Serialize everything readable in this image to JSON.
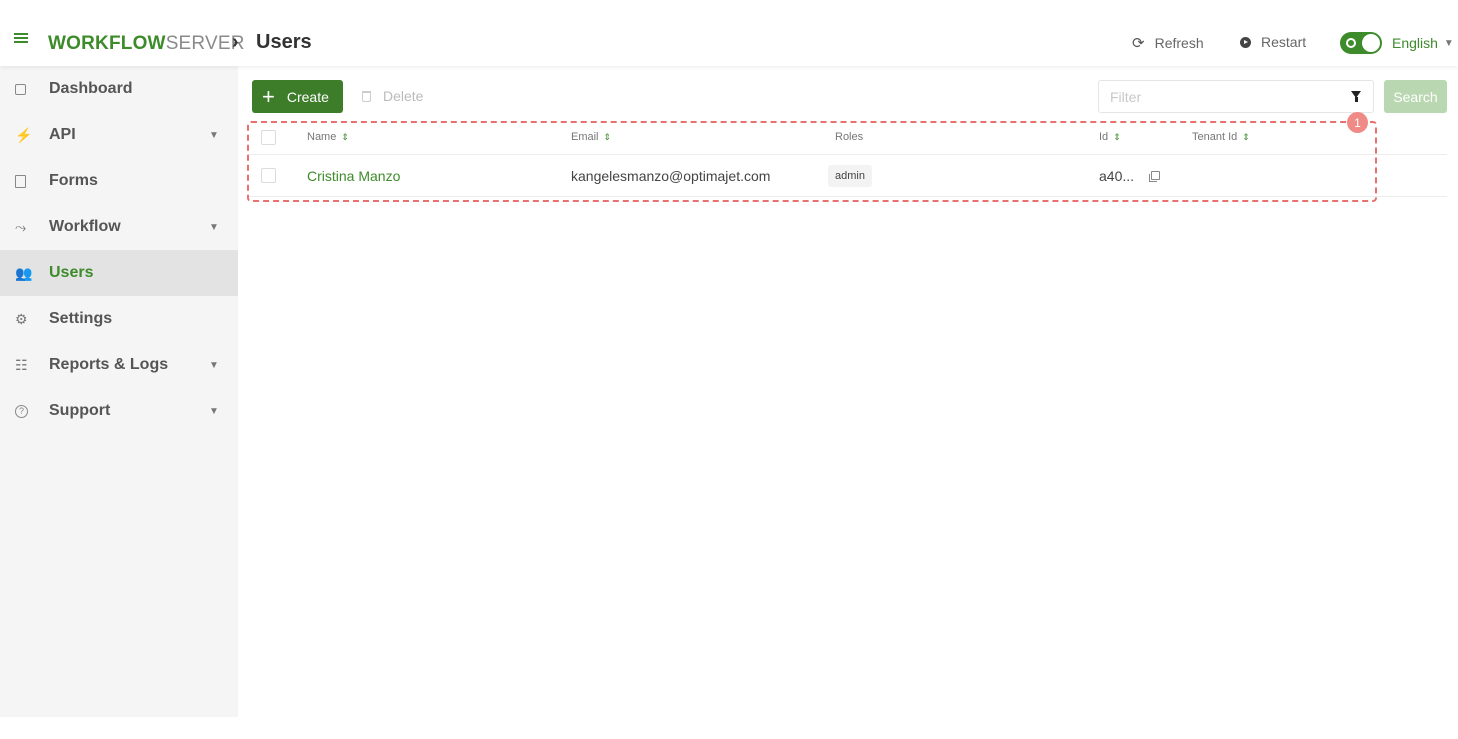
{
  "header": {
    "logo_w": "W",
    "logo_orkflow": "ORKFLOW",
    "logo_server": "SERVER",
    "breadcrumb_sep": "›",
    "page_title": "Users",
    "refresh_label": "Refresh",
    "restart_label": "Restart",
    "language": "English"
  },
  "sidebar": {
    "items": [
      {
        "label": "Dashboard",
        "icon": "dashboard-icon"
      },
      {
        "label": "API",
        "icon": "plug-icon",
        "expandable": true
      },
      {
        "label": "Forms",
        "icon": "form-icon"
      },
      {
        "label": "Workflow",
        "icon": "workflow-icon",
        "expandable": true
      },
      {
        "label": "Users",
        "icon": "users-icon",
        "active": true
      },
      {
        "label": "Settings",
        "icon": "gears-icon"
      },
      {
        "label": "Reports & Logs",
        "icon": "reports-icon",
        "expandable": true
      },
      {
        "label": "Support",
        "icon": "help-icon",
        "expandable": true
      }
    ]
  },
  "toolbar": {
    "create_label": "Create",
    "delete_label": "Delete",
    "filter_placeholder": "Filter",
    "search_label": "Search"
  },
  "table": {
    "columns": {
      "name": "Name",
      "email": "Email",
      "roles": "Roles",
      "id": "Id",
      "tenant_id": "Tenant Id"
    },
    "rows": [
      {
        "name": "Cristina Manzo",
        "email": "kangelesmanzo@optimajet.com",
        "role": "admin",
        "id": "a40...",
        "tenant_id": ""
      }
    ]
  },
  "annotation": {
    "badge": "1"
  },
  "colors": {
    "accent": "#3d8b2a",
    "highlight": "#e8706e",
    "search_disabled": "#b9d7b0"
  }
}
